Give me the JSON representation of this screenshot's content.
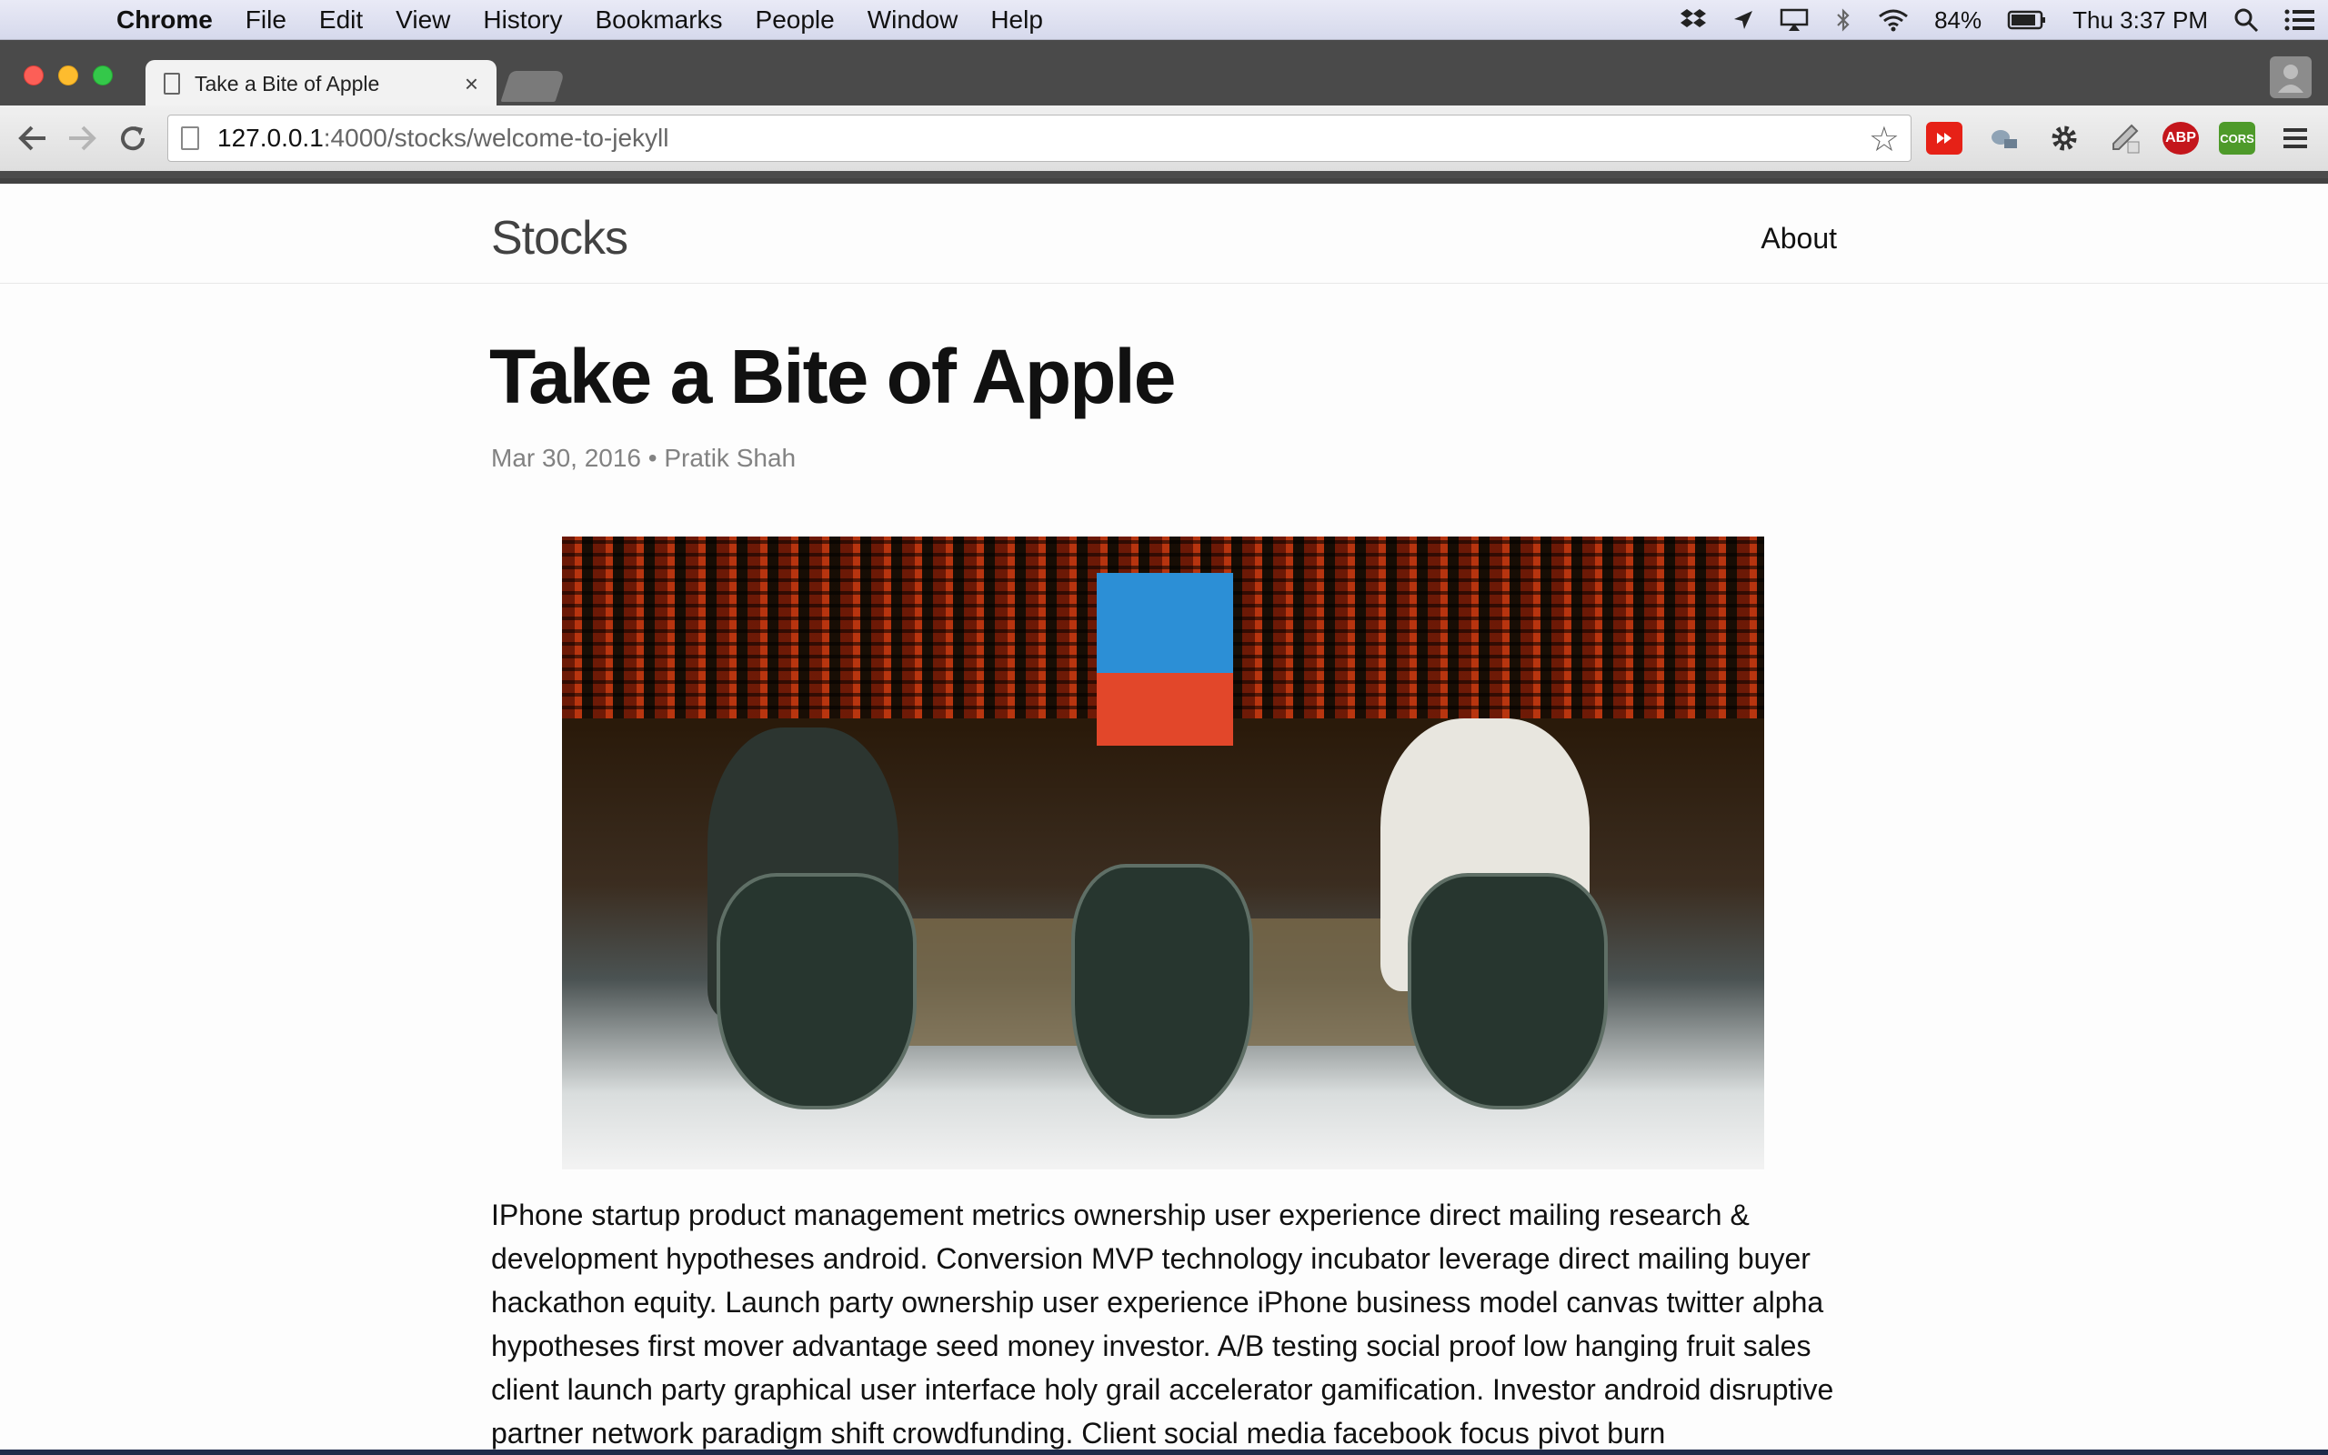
{
  "menubar": {
    "app_name": "Chrome",
    "items": [
      "File",
      "Edit",
      "View",
      "History",
      "Bookmarks",
      "People",
      "Window",
      "Help"
    ],
    "battery": "84%",
    "clock": "Thu 3:37 PM",
    "icons": [
      "apple-icon",
      "dropbox-icon",
      "location-icon",
      "airplay-icon",
      "bluetooth-icon",
      "wifi-icon",
      "battery-icon",
      "spotlight-icon",
      "notification-center-icon"
    ]
  },
  "browser": {
    "tab_title": "Take a Bite of Apple",
    "tab_close": "×",
    "url_host": "127.0.0.1",
    "url_path": ":4000/stocks/welcome-to-jekyll",
    "extensions": [
      "youtube-icon",
      "satellite-icon",
      "gear-icon",
      "eyedropper-icon",
      "adblock-icon",
      "cors-icon",
      "menu-icon"
    ],
    "ext_labels": {
      "abp": "ABP",
      "cors": "CORS"
    }
  },
  "site": {
    "title": "Stocks",
    "nav_about": "About"
  },
  "post": {
    "title": "Take a Bite of Apple",
    "meta": "Mar 30, 2016 • Pratik Shah",
    "body": "IPhone startup product management metrics ownership user experience direct mailing research & development hypotheses android. Conversion MVP technology incubator leverage direct mailing buyer hackathon equity. Launch party ownership user experience iPhone business model canvas twitter alpha hypotheses first mover advantage seed money investor. A/B testing social proof low hanging fruit sales client launch party graphical user interface holy grail accelerator gamification. Investor android disruptive partner network paradigm shift crowdfunding. Client social media facebook focus pivot burn"
  }
}
